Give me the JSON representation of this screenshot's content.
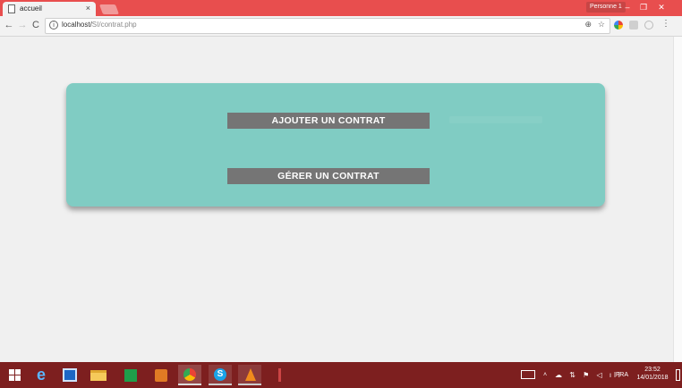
{
  "browser": {
    "tab_title": "accueil",
    "tab_close": "×",
    "profile_label": "Personne 1",
    "window_controls": {
      "minimize": "–",
      "maximize": "❐",
      "close": "✕"
    },
    "nav": {
      "back": "←",
      "forward": "→",
      "reload": "C"
    },
    "url": {
      "host": "localhost/",
      "path": "SI/contrat.php"
    },
    "info_icon": "i",
    "zoom_icon": "⊕",
    "star_icon": "☆",
    "menu_icon": "⋮"
  },
  "page": {
    "buttons": {
      "add_contract": "AJOUTER UN CONTRAT",
      "manage_contract": "GÉRER UN CONTRAT"
    },
    "colors": {
      "panel": "#80ccc3",
      "button": "#757575",
      "background": "#f0f0f0"
    }
  },
  "taskbar": {
    "apps": [
      "start-icon",
      "internet-explorer-icon",
      "teamviewer-icon",
      "file-explorer-icon",
      "store-icon",
      "media-player-icon",
      "chrome-icon",
      "skype-icon",
      "vlc-icon",
      "misc-app-icon"
    ],
    "tray": {
      "up_arrow": "˄",
      "icons": "☁ ⇅ ⚑ ◁ ıll",
      "language": "FRA",
      "time": "23:52",
      "date": "14/01/2018"
    },
    "ie_glyph": "e",
    "skype_glyph": "S"
  }
}
